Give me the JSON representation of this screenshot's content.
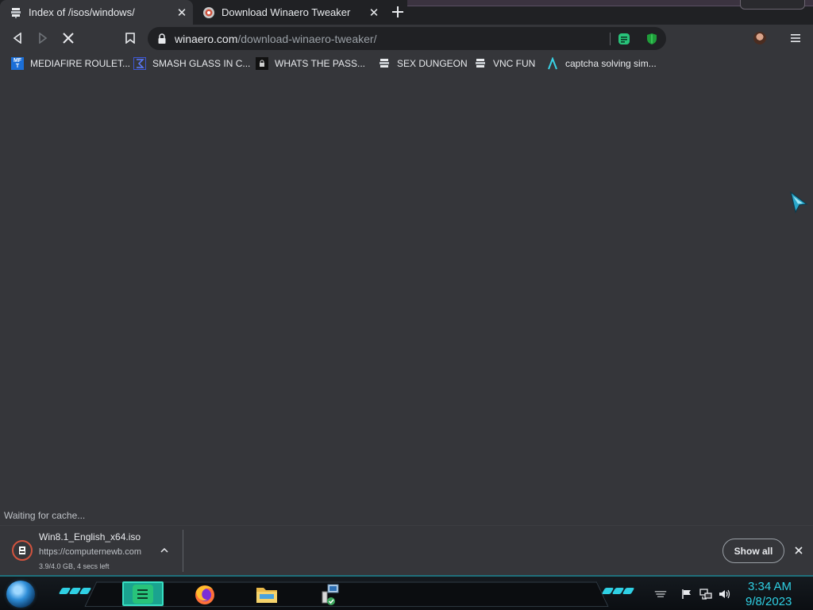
{
  "tabs": [
    {
      "title": "Index of /isos/windows/",
      "favicon": "server-icon",
      "active": true
    },
    {
      "title": "Download Winaero Tweaker",
      "favicon": "winaero-icon",
      "active": false
    }
  ],
  "toolbar": {
    "url_domain": "winaero.com",
    "url_path": "/download-winaero-tweaker/"
  },
  "bookmarks": [
    {
      "label": "MEDIAFIRE ROULET...",
      "icon": "mediafire-icon",
      "icon_text": "MF\nT"
    },
    {
      "label": "SMASH GLASS IN C...",
      "icon": "sigma-icon"
    },
    {
      "label": "WHATS THE PASS...",
      "icon": "lock-icon"
    },
    {
      "label": "SEX DUNGEON",
      "icon": "server-icon"
    },
    {
      "label": "VNC FUN",
      "icon": "server-icon"
    },
    {
      "label": "captcha solving sim...",
      "icon": "lambda-icon"
    }
  ],
  "status": {
    "text": "Waiting for cache..."
  },
  "download": {
    "filename": "Win8.1_English_x64.iso",
    "source": "https://computernewb.com",
    "progress_text": "3.9/4.0 GB, 4 secs left"
  },
  "shelf": {
    "show_all_label": "Show all"
  },
  "taskbar": {
    "time": "3:34 AM",
    "date": "9/8/2023"
  },
  "colors": {
    "accent": "#2fd0e4",
    "page_bg": "#35363a",
    "tabstrip_bg": "#202124"
  }
}
